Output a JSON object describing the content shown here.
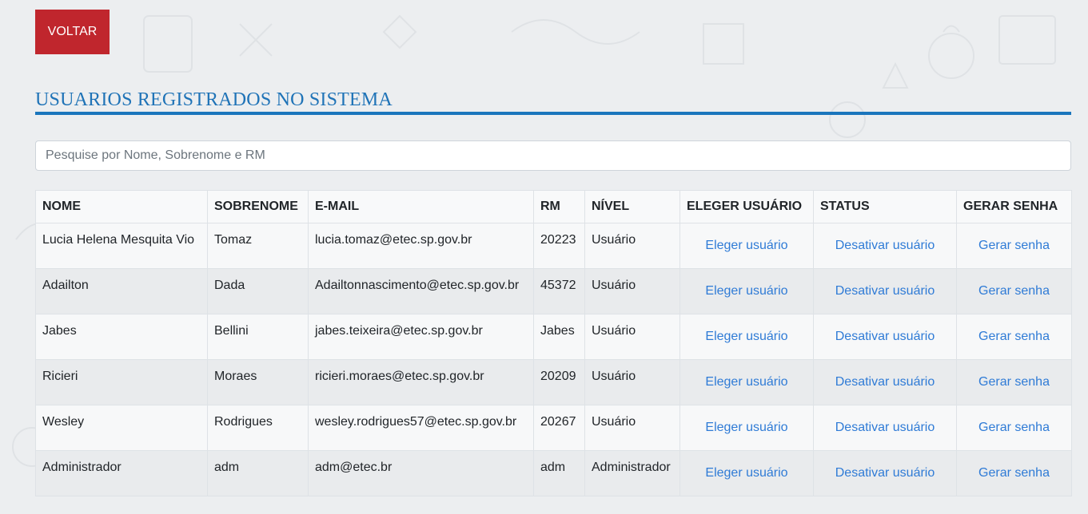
{
  "back_button": {
    "label": "VOLTAR"
  },
  "title": "USUARIOS REGISTRADOS NO SISTEMA",
  "search": {
    "placeholder": "Pesquise por Nome, Sobrenome e RM",
    "value": ""
  },
  "table": {
    "headers": [
      "NOME",
      "SOBRENOME",
      "E-MAIL",
      "RM",
      "NÍVEL",
      "ELEGER USUÁRIO",
      "STATUS",
      "GERAR SENHA"
    ],
    "rows": [
      {
        "nome": "Lucia Helena Mesquita Vio",
        "sobrenome": "Tomaz",
        "email": "lucia.tomaz@etec.sp.gov.br",
        "rm": "20223",
        "nivel": "Usuário",
        "eleger": "Eleger usuário",
        "status": "Desativar usuário",
        "senha": "Gerar senha"
      },
      {
        "nome": "Adailton",
        "sobrenome": "Dada",
        "email": "Adailtonnascimento@etec.sp.gov.br",
        "rm": "45372",
        "nivel": "Usuário",
        "eleger": "Eleger usuário",
        "status": "Desativar usuário",
        "senha": "Gerar senha"
      },
      {
        "nome": "Jabes",
        "sobrenome": "Bellini",
        "email": "jabes.teixeira@etec.sp.gov.br",
        "rm": "Jabes",
        "nivel": "Usuário",
        "eleger": "Eleger usuário",
        "status": "Desativar usuário",
        "senha": "Gerar senha"
      },
      {
        "nome": "Ricieri",
        "sobrenome": "Moraes",
        "email": "ricieri.moraes@etec.sp.gov.br",
        "rm": "20209",
        "nivel": "Usuário",
        "eleger": "Eleger usuário",
        "status": "Desativar usuário",
        "senha": "Gerar senha"
      },
      {
        "nome": "Wesley",
        "sobrenome": "Rodrigues",
        "email": "wesley.rodrigues57@etec.sp.gov.br",
        "rm": "20267",
        "nivel": "Usuário",
        "eleger": "Eleger usuário",
        "status": "Desativar usuário",
        "senha": "Gerar senha"
      },
      {
        "nome": "Administrador",
        "sobrenome": "adm",
        "email": "adm@etec.br",
        "rm": "adm",
        "nivel": "Administrador",
        "eleger": "Eleger usuário",
        "status": "Desativar usuário",
        "senha": "Gerar senha"
      }
    ]
  },
  "colors": {
    "accent": "#1a75bc",
    "back_button": "#c0262d",
    "link": "#2f7bd6"
  }
}
